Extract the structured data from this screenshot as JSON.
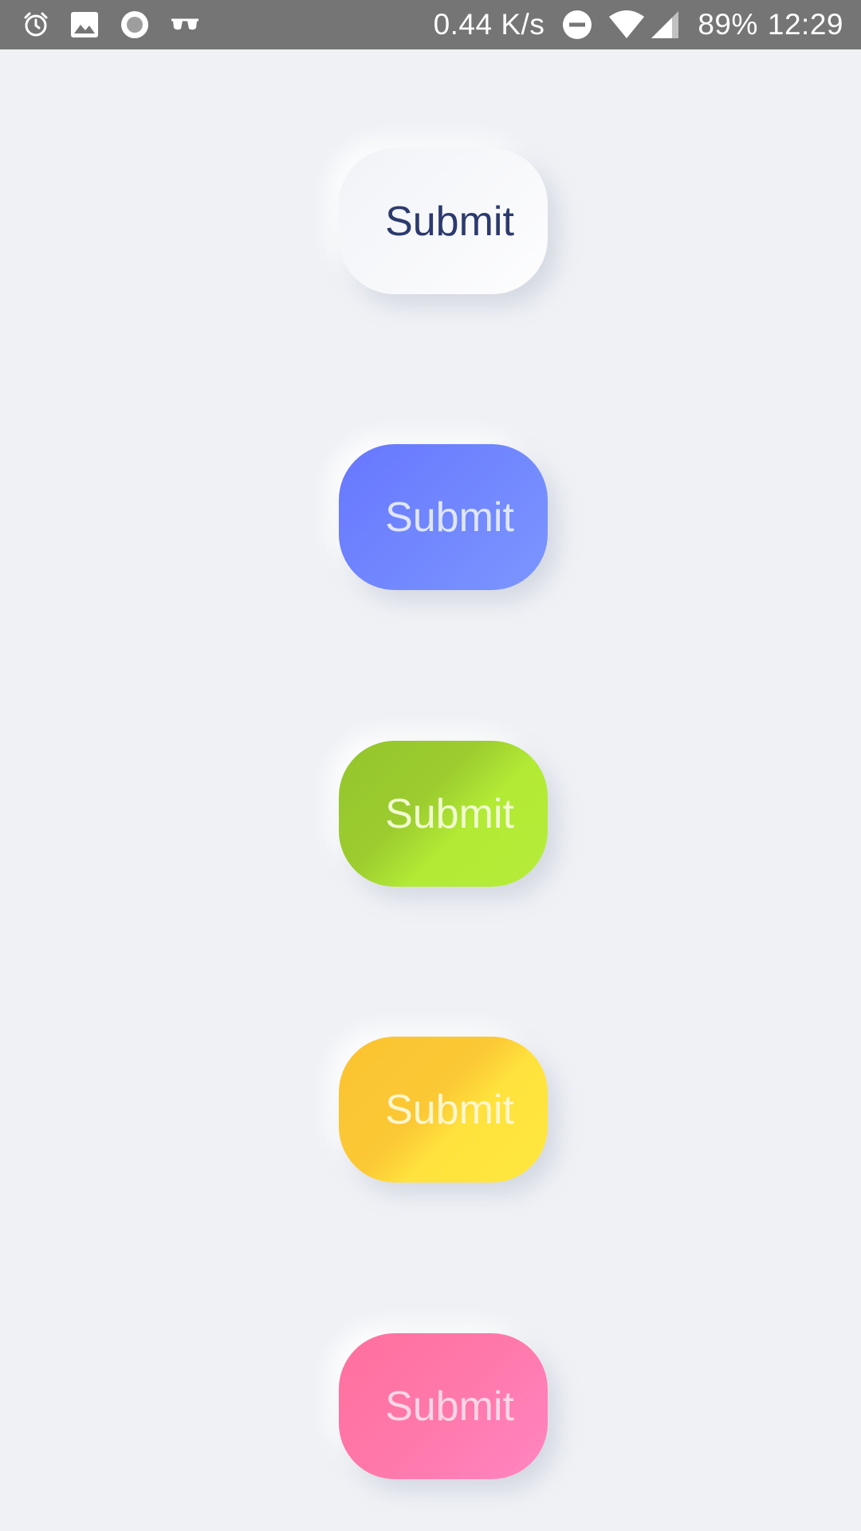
{
  "status_bar": {
    "left_icons": [
      "alarm-icon",
      "image-icon",
      "record-icon",
      "glasses-icon"
    ],
    "network_speed": "0.44 K/s",
    "right_icons": [
      "do-not-disturb-icon",
      "wifi-icon",
      "cellular-signal-icon"
    ],
    "battery": "89%",
    "time": "12:29",
    "background": "#757575"
  },
  "buttons": [
    {
      "label": "Submit",
      "style": "white",
      "text_color": "#2c3a6e",
      "gradient": [
        "#f1f3f7",
        "#fdfdfe"
      ]
    },
    {
      "label": "Submit",
      "style": "blue",
      "text_color": "#dfe6ff",
      "gradient": [
        "#6777ff",
        "#7b96fe"
      ]
    },
    {
      "label": "Submit",
      "style": "green",
      "text_color": "#f1fbd2",
      "gradient": [
        "#93c52c",
        "#b4ec3a"
      ]
    },
    {
      "label": "Submit",
      "style": "yellow",
      "text_color": "#fff6cf",
      "gradient": [
        "#fbc331",
        "#ffe83f"
      ]
    },
    {
      "label": "Submit",
      "style": "pink",
      "text_color": "#ffd6e6",
      "gradient": [
        "#ff6f9e",
        "#ff86c2"
      ]
    }
  ],
  "page_background": "#eff1f5"
}
